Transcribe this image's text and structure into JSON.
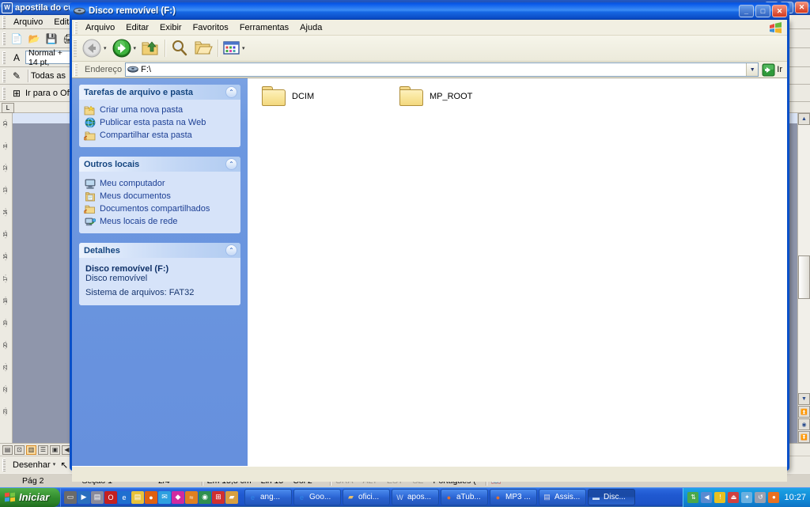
{
  "word": {
    "title": "apostila do curso - Microsoft Word",
    "icon_name": "word-icon",
    "menus": [
      "Arquivo",
      "Editar"
    ],
    "style_value": "Normal + 14 pt,",
    "toolbar3_label": "Todas as",
    "toolbar4_label": "Ir para o Office",
    "ruler_ticks": [
      "10",
      "11",
      "12",
      "13",
      "14",
      "15",
      "16",
      "17",
      "18",
      "19",
      "20",
      "21",
      "22",
      "23"
    ],
    "draw_label": "Desenhar",
    "status": {
      "page": "Pág  2",
      "section": "Seção  1",
      "pages": "2/4",
      "position": "Em  15,8 cm",
      "line": "Lin  15",
      "column": "Col  2",
      "gra": "GRA",
      "alt": "ALT",
      "est": "EST",
      "se": "SE",
      "language": "Português ("
    },
    "window_controls": {
      "minimize": "_",
      "maximize": "□",
      "close": "✕"
    }
  },
  "explorer": {
    "title": "Disco removível (F:)",
    "icon_name": "removable-disk-icon",
    "window_controls": {
      "minimize": "_",
      "maximize": "□",
      "close": "✕"
    },
    "menus": [
      "Arquivo",
      "Editar",
      "Exibir",
      "Favoritos",
      "Ferramentas",
      "Ajuda"
    ],
    "toolbar": [
      {
        "name": "back-button",
        "glyph": "←",
        "has_caret": true
      },
      {
        "name": "forward-button",
        "glyph": "→",
        "has_caret": true
      },
      {
        "name": "up-button",
        "glyph": "↑",
        "has_caret": false
      },
      {
        "name": "search-button",
        "glyph": "🔍",
        "has_caret": false
      },
      {
        "name": "folders-button",
        "glyph": "📂",
        "has_caret": false
      },
      {
        "name": "views-button",
        "glyph": "▦",
        "has_caret": true
      }
    ],
    "address": {
      "label": "Endereço",
      "value": "F:\\",
      "placeholder": "F:\\",
      "go_label": "Ir"
    },
    "sidebar": {
      "panels": [
        {
          "title": "Tarefas de arquivo e pasta",
          "collapse_glyph": "⌃",
          "links": [
            {
              "label": "Criar uma nova pasta",
              "icon": "new-folder-icon"
            },
            {
              "label": "Publicar esta pasta na Web",
              "icon": "globe-icon"
            },
            {
              "label": "Compartilhar esta pasta",
              "icon": "shared-folder-icon"
            }
          ]
        },
        {
          "title": "Outros locais",
          "collapse_glyph": "⌃",
          "links": [
            {
              "label": "Meu computador",
              "icon": "my-computer-icon"
            },
            {
              "label": "Meus documentos",
              "icon": "my-documents-icon"
            },
            {
              "label": "Documentos compartilhados",
              "icon": "shared-documents-icon"
            },
            {
              "label": "Meus locais de rede",
              "icon": "network-places-icon"
            }
          ]
        }
      ],
      "details": {
        "title": "Detalhes",
        "collapse_glyph": "⌃",
        "name": "Disco removível (F:)",
        "type": "Disco removível",
        "filesystem": "Sistema de arquivos: FAT32"
      }
    },
    "files": [
      {
        "name": "DCIM",
        "icon": "folder-icon"
      },
      {
        "name": "MP_ROOT",
        "icon": "folder-icon"
      }
    ]
  },
  "taskbar": {
    "start_label": "Iniciar",
    "quicklaunch": [
      {
        "name": "show-desktop-icon",
        "glyph": "▭",
        "color": "#6a6a6a"
      },
      {
        "name": "media-player-icon",
        "glyph": "▶",
        "color": "#2a6fbf"
      },
      {
        "name": "printer-icon",
        "glyph": "▤",
        "color": "#8a8a9a"
      },
      {
        "name": "opera-icon",
        "glyph": "O",
        "color": "#c42020"
      },
      {
        "name": "internet-explorer-icon",
        "glyph": "e",
        "color": "#1f6fd0"
      },
      {
        "name": "notepad-icon",
        "glyph": "▤",
        "color": "#e8c23a"
      },
      {
        "name": "firefox-icon",
        "glyph": "●",
        "color": "#e06010"
      },
      {
        "name": "messenger-icon",
        "glyph": "✉",
        "color": "#2ea0e0"
      },
      {
        "name": "emule-icon",
        "glyph": "◆",
        "color": "#d02aa0"
      },
      {
        "name": "winamp-icon",
        "glyph": "≈",
        "color": "#e08020"
      },
      {
        "name": "media-icon",
        "glyph": "◉",
        "color": "#2f8f4f"
      },
      {
        "name": "windows-icon",
        "glyph": "⊞",
        "color": "#d03030"
      },
      {
        "name": "folder-icon",
        "glyph": "▰",
        "color": "#d8a040"
      }
    ],
    "tasks": [
      {
        "label": "ang...",
        "icon": "internet-explorer-icon",
        "glyph": "e",
        "color": "#2f86e8",
        "active": false
      },
      {
        "label": "Goo...",
        "icon": "internet-explorer-icon",
        "glyph": "e",
        "color": "#2f86e8",
        "active": false
      },
      {
        "label": "ofici...",
        "icon": "folder-icon",
        "glyph": "▰",
        "color": "#e8c06a",
        "active": false
      },
      {
        "label": "apos...",
        "icon": "word-icon",
        "glyph": "W",
        "color": "#c8d8f0",
        "active": false
      },
      {
        "label": "aTub...",
        "icon": "firefox-icon",
        "glyph": "●",
        "color": "#e07030",
        "active": false
      },
      {
        "label": "MP3 ...",
        "icon": "firefox-icon",
        "glyph": "●",
        "color": "#e07030",
        "active": false
      },
      {
        "label": "Assis...",
        "icon": "assistant-icon",
        "glyph": "▤",
        "color": "#d8d8e8",
        "active": false
      },
      {
        "label": "Disc...",
        "icon": "removable-disk-icon",
        "glyph": "▬",
        "color": "#cfe0f5",
        "active": true
      }
    ],
    "tray": [
      {
        "name": "network-icon",
        "glyph": "⇅",
        "color": "#4aa84a"
      },
      {
        "name": "volume-icon",
        "glyph": "◀",
        "color": "#5a8ad0"
      },
      {
        "name": "shield-icon",
        "glyph": "!",
        "color": "#e8c020"
      },
      {
        "name": "safely-remove-icon",
        "glyph": "⏏",
        "color": "#d04040"
      },
      {
        "name": "antivirus-icon",
        "glyph": "✦",
        "color": "#6ab0e0"
      },
      {
        "name": "history-icon",
        "glyph": "↺",
        "color": "#9aa0b0"
      },
      {
        "name": "update-icon",
        "glyph": "●",
        "color": "#e87020"
      }
    ],
    "clock": "10:27"
  }
}
